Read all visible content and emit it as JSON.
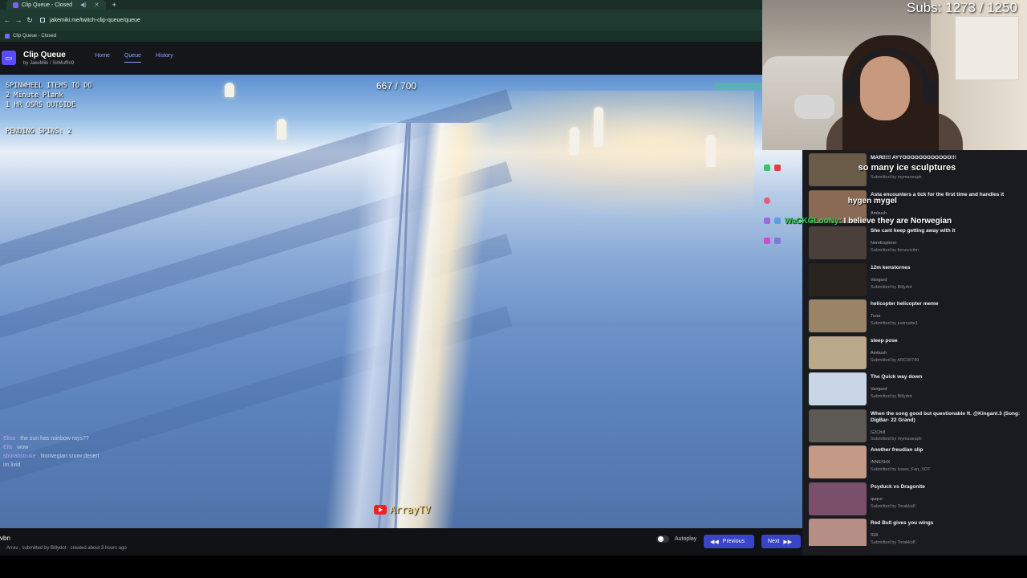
{
  "browser": {
    "tab_title": "Clip Queue - Closed",
    "url": "jakemiki.me/twitch-clip-queue/queue",
    "bookmark": "Clip Queue - Closed"
  },
  "app": {
    "title": "Clip Queue",
    "byline": "by JakeMiki / SirMuffin9",
    "nav": [
      "Home",
      "Queue",
      "History"
    ]
  },
  "video": {
    "spinwheel_lines": [
      "SPINWHEEL ITEMS TO DO",
      "2 Minute Plank",
      "1 HR OSRS OUTSIDE"
    ],
    "pending_spins": "PENDING SPINS: 2",
    "counter": "667 / 700",
    "channel_watermark": "ArrayTV",
    "chat": [
      {
        "user": "Elisa",
        "text": "the sun has rainbow rays??"
      },
      {
        "user": "Elis",
        "text": "wow"
      },
      {
        "user": "",
        "text": ""
      },
      {
        "user": "shurabstruke",
        "text": "Norwegian snow desert"
      },
      {
        "user": "",
        "text": "im livid"
      }
    ]
  },
  "clip": {
    "title": "vbn",
    "meta": "Arrav , submitted by Billydot · created about 3 hours ago"
  },
  "controls": {
    "autoplay_label": "Autoplay",
    "previous_label": "Previous",
    "next_label": "Next"
  },
  "stream": {
    "subs": "Subs: 1273 / 1250",
    "chat": [
      {
        "user": "",
        "text": "so many ice sculptures",
        "color": "#e04040"
      },
      {
        "user": "",
        "text": "hygen mygel",
        "color": "#e85a7a"
      },
      {
        "user": "WaCKGLooNy:",
        "text": "I believe they are Norwegian",
        "color": "#37d65a"
      },
      {
        "user": "",
        "text": "",
        "color": "#e04040"
      }
    ]
  },
  "queue": [
    {
      "title": "MARI!!!! AYYOOOOOOOOOOOO!!!",
      "channel": "",
      "submitted": "Submitted by mymanesph",
      "thumb": "#6a5a48"
    },
    {
      "title": "Asta encounters a tick for the first time and handles it",
      "channel": "Ambush",
      "submitted": "",
      "thumb": "#8a6a55"
    },
    {
      "title": "She cant keep getting away with it",
      "channel": "NoreExplorer",
      "submitted": "Submitted by fomovictim",
      "thumb": "#4a3f3a"
    },
    {
      "title": "12m kenstornes",
      "channel": "Vangard",
      "submitted": "Submitted by Billydot",
      "thumb": "#2a2420"
    },
    {
      "title": "helicopter helicopter meme",
      "channel": "Tuna",
      "submitted": "Submitted by justmatte1",
      "thumb": "#9a8468"
    },
    {
      "title": "sleep pose",
      "channel": "Ambush",
      "submitted": "Submitted by ARC00749",
      "thumb": "#b9a88a"
    },
    {
      "title": "The Quick way down",
      "channel": "Vangard",
      "submitted": "Submitted by Billydot",
      "thumb": "#c9d6e6"
    },
    {
      "title": "When the song good but questionable ft. @Kingant.3 (Song: DigBar- 22 Grand)",
      "channel": "G2Chill",
      "submitted": "Submitted by mymanesph",
      "thumb": "#5d5a55"
    },
    {
      "title": "Another freudian slip",
      "channel": "INNESHX",
      "submitted": "Submitted by Isaws_Fan_SOT",
      "thumb": "#c49a86"
    },
    {
      "title": "Psyduck vs Dragonite",
      "channel": "quqco",
      "submitted": "Submitted by Torakko8",
      "thumb": "#7a4f6a"
    },
    {
      "title": "Red Bull gives you wings",
      "channel": "318",
      "submitted": "Submitted by Torakko8",
      "thumb": "#b58f86"
    }
  ]
}
